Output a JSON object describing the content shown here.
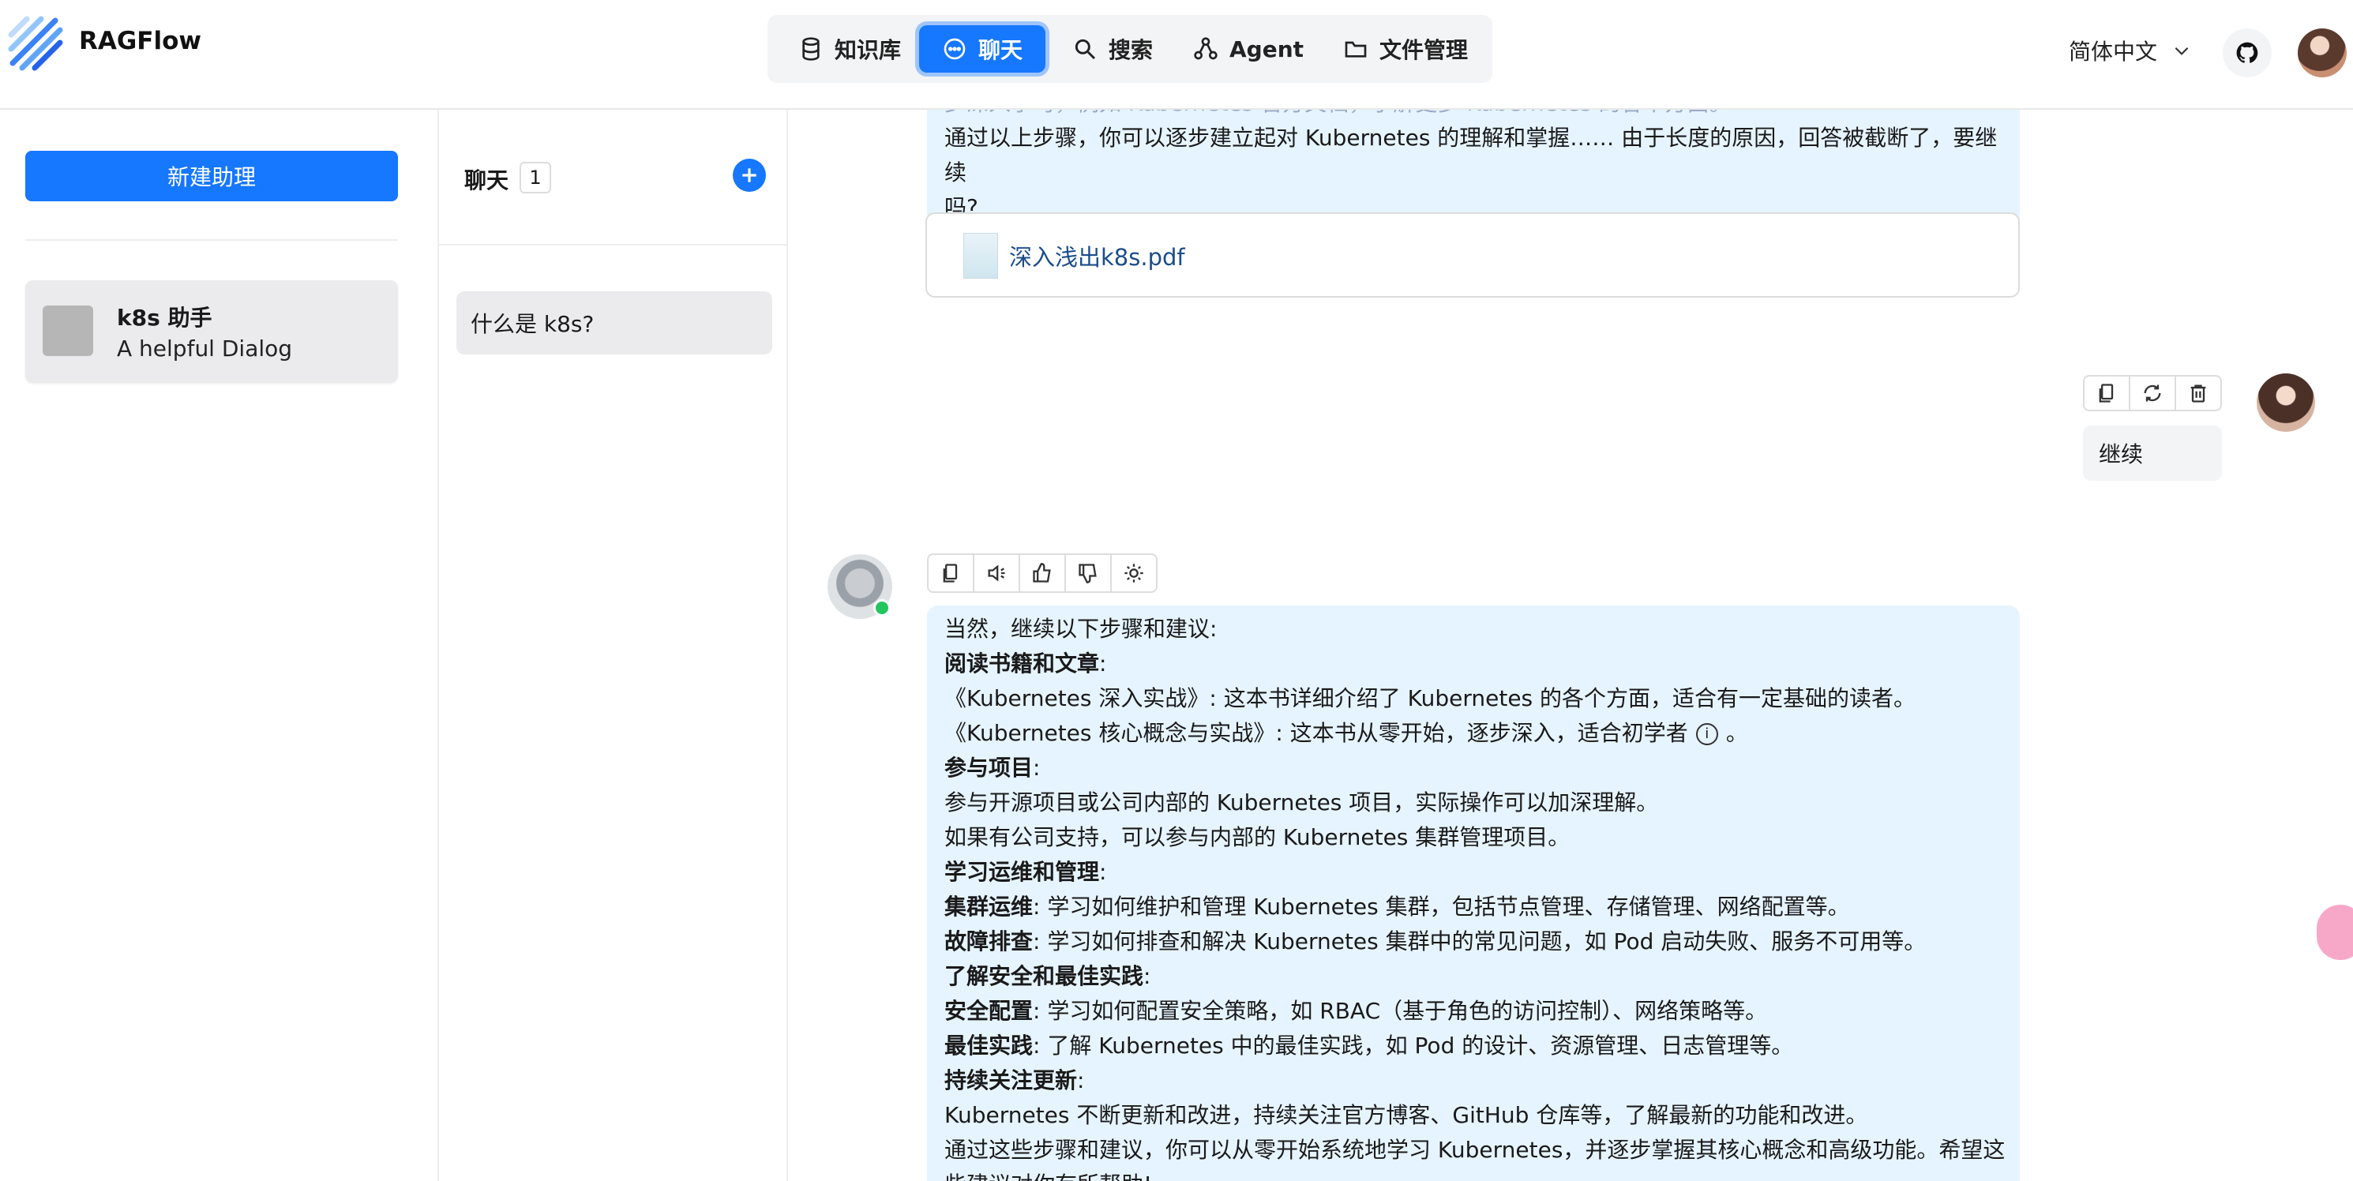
{
  "header": {
    "brand": "RAGFlow",
    "nav": [
      {
        "label": "知识库",
        "icon": "database-icon"
      },
      {
        "label": "聊天",
        "icon": "chat-icon",
        "active": true
      },
      {
        "label": "搜索",
        "icon": "search-icon"
      },
      {
        "label": "Agent",
        "icon": "agent-icon"
      },
      {
        "label": "文件管理",
        "icon": "folder-icon"
      }
    ],
    "language": "简体中文",
    "accent_color": "#1677ff"
  },
  "sidebar": {
    "new_assistant_label": "新建助理",
    "assistants": [
      {
        "name": "k8s 助手",
        "description": "A helpful Dialog"
      }
    ]
  },
  "conversations": {
    "title": "聊天",
    "count": "1",
    "items": [
      {
        "title": "什么是 k8s?"
      }
    ]
  },
  "messages": {
    "first_partial": {
      "lines": [
        "步深入学习，例如 Kubernetes 官方文档，了解更多 Kubernetes 的各个方面。",
        "通过以上步骤，你可以逐步建立起对 Kubernetes 的理解和掌握…… 由于长度的原因，回答被截断了，要继续",
        "吗?"
      ],
      "reference_doc": "深入浅出k8s.pdf"
    },
    "user_message": "继续",
    "assistant_reply": [
      {
        "text": "当然，继续以下步骤和建议:"
      },
      {
        "bold": "阅读书籍和文章",
        "text": ":"
      },
      {
        "text": "《Kubernetes 深入实战》: 这本书详细介绍了 Kubernetes 的各个方面，适合有一定基础的读者。"
      },
      {
        "text": "《Kubernetes 核心概念与实战》: 这本书从零开始，逐步深入，适合初学者",
        "tail": "。"
      },
      {
        "bold": "参与项目",
        "text": ":"
      },
      {
        "text": "参与开源项目或公司内部的 Kubernetes 项目，实际操作可以加深理解。"
      },
      {
        "text": "如果有公司支持，可以参与内部的 Kubernetes 集群管理项目。"
      },
      {
        "bold": "学习运维和管理",
        "text": ":"
      },
      {
        "bold": "集群运维",
        "text": ": 学习如何维护和管理 Kubernetes 集群，包括节点管理、存储管理、网络配置等。"
      },
      {
        "bold": "故障排查",
        "text": ": 学习如何排查和解决 Kubernetes 集群中的常见问题，如 Pod 启动失败、服务不可用等。"
      },
      {
        "bold": "了解安全和最佳实践",
        "text": ":"
      },
      {
        "bold": "安全配置",
        "text": ": 学习如何配置安全策略，如 RBAC（基于角色的访问控制）、网络策略等。"
      },
      {
        "bold": "最佳实践",
        "text": ": 了解 Kubernetes 中的最佳实践，如 Pod 的设计、资源管理、日志管理等。"
      },
      {
        "bold": "持续关注更新",
        "text": ":"
      },
      {
        "text": "Kubernetes 不断更新和改进，持续关注官方博客、GitHub 仓库等，了解最新的功能和改进。"
      },
      {
        "text": "通过这些步骤和建议，你可以从零开始系统地学习 Kubernetes，并逐步掌握其核心概念和高级功能。希望这"
      },
      {
        "text": "些建议对你有所帮助!"
      }
    ]
  }
}
